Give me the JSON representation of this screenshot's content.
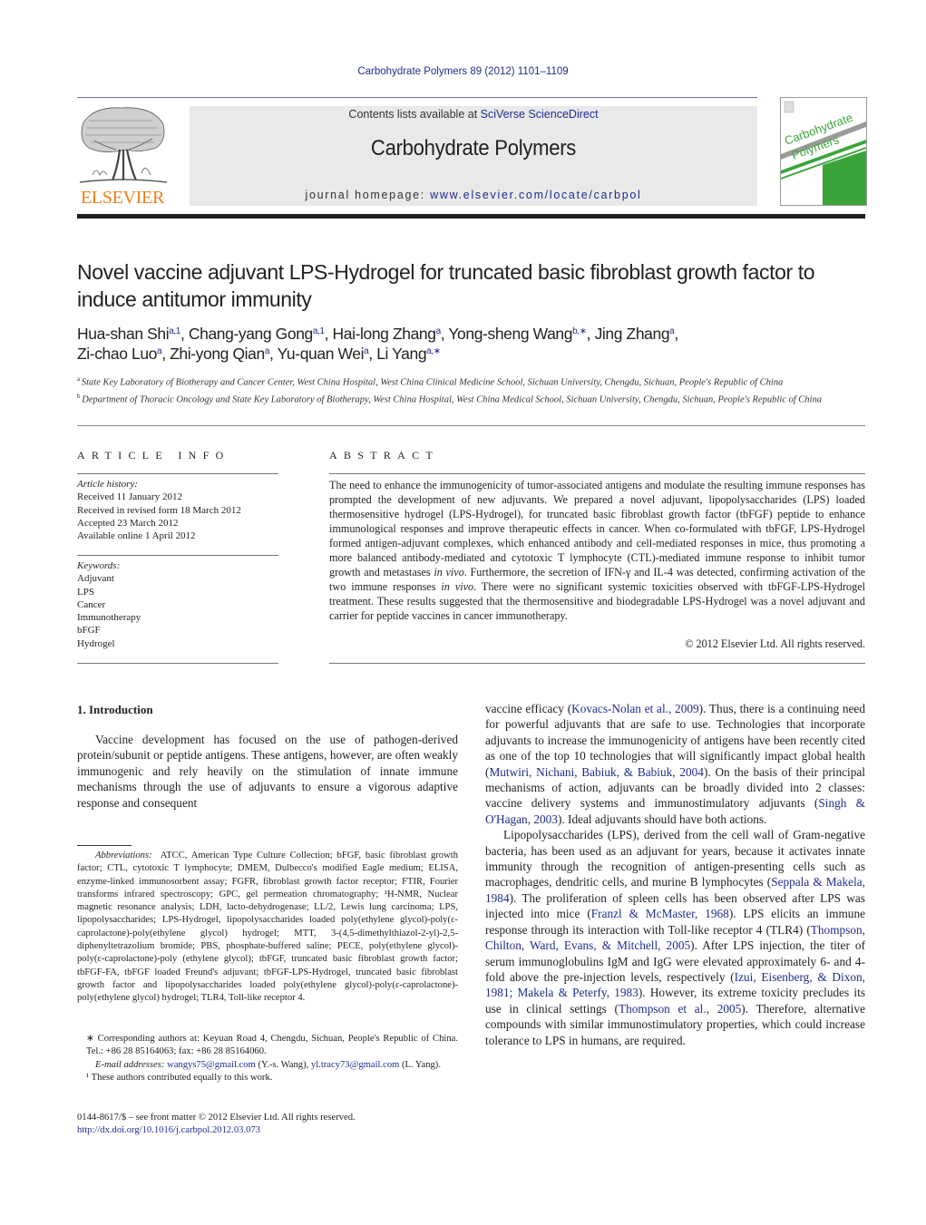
{
  "header": {
    "journal_reference": "Carbohydrate Polymers 89 (2012) 1101–1109",
    "publisher_logo_text": "ELSEVIER",
    "contents_prefix": "Contents lists available at ",
    "contents_link": "SciVerse ScienceDirect",
    "journal_title": "Carbohydrate Polymers",
    "homepage_prefix": "journal homepage: ",
    "homepage_link": "www.elsevier.com/locate/carbpol",
    "cover_title_line1": "Carbohydrate",
    "cover_title_line2": "Polymers",
    "colors": {
      "link": "#1f2c8f",
      "elsevier_orange": "#f07f1a",
      "cover_green": "#3aa43a",
      "masthead_gray": "#e9e9e9"
    }
  },
  "article": {
    "title": "Novel vaccine adjuvant LPS-Hydrogel for truncated basic fibroblast growth factor to induce antitumor immunity",
    "authors": [
      {
        "name": "Hua-shan Shi",
        "sup": "a,1"
      },
      {
        "name": "Chang-yang Gong",
        "sup": "a,1"
      },
      {
        "name": "Hai-long Zhang",
        "sup": "a"
      },
      {
        "name": "Yong-sheng Wang",
        "sup": "b,∗"
      },
      {
        "name": "Jing Zhang",
        "sup": "a"
      },
      {
        "name": "Zi-chao Luo",
        "sup": "a"
      },
      {
        "name": "Zhi-yong Qian",
        "sup": "a"
      },
      {
        "name": "Yu-quan Wei",
        "sup": "a"
      },
      {
        "name": "Li Yang",
        "sup": "a,∗"
      }
    ],
    "affiliations": [
      {
        "key": "a",
        "text": "State Key Laboratory of Biotherapy and Cancer Center, West China Hospital, West China Clinical Medicine School, Sichuan University, Chengdu, Sichuan, People's Republic of China"
      },
      {
        "key": "b",
        "text": "Department of Thoracic Oncology and State Key Laboratory of Biotherapy, West China Hospital, West China Medical School, Sichuan University, Chengdu, Sichuan, People's Republic of China"
      }
    ]
  },
  "article_info": {
    "heading": "ARTICLE INFO",
    "history_label": "Article history:",
    "history": [
      "Received 11 January 2012",
      "Received in revised form 18 March 2012",
      "Accepted 23 March 2012",
      "Available online 1 April 2012"
    ],
    "keywords_label": "Keywords:",
    "keywords": [
      "Adjuvant",
      "LPS",
      "Cancer",
      "Immunotherapy",
      "bFGF",
      "Hydrogel"
    ]
  },
  "abstract": {
    "heading": "ABSTRACT",
    "part1": "The need to enhance the immunogenicity of tumor-associated antigens and modulate the resulting immune responses has prompted the development of new adjuvants. We prepared a novel adjuvant, lipopolysaccharides (LPS) loaded thermosensitive hydrogel (LPS-Hydrogel), for truncated basic fibroblast growth factor (tbFGF) peptide to enhance immunological responses and improve therapeutic effects in cancer. When co-formulated with tbFGF, LPS-Hydrogel formed antigen-adjuvant complexes, which enhanced antibody and cell-mediated responses in mice, thus promoting a more balanced antibody-mediated and cytotoxic T lymphocyte (CTL)-mediated immune response to inhibit tumor growth and metastases ",
    "italic1": "in vivo",
    "part2": ". Furthermore, the secretion of IFN-γ and IL-4 was detected, confirming activation of the two immune responses ",
    "italic2": "in vivo",
    "part3": ". There were no significant systemic toxicities observed with tbFGF-LPS-Hydrogel treatment. These results suggested that the thermosensitive and biodegradable LPS-Hydrogel was a novel adjuvant and carrier for peptide vaccines in cancer immunotherapy.",
    "copyright": "© 2012 Elsevier Ltd. All rights reserved."
  },
  "introduction": {
    "heading": "1.  Introduction",
    "left_paragraph": "Vaccine development has focused on the use of pathogen-derived protein/subunit or peptide antigens. These antigens, however, are often weakly immunogenic and rely heavily on the stimulation of innate immune mechanisms through the use of adjuvants to ensure a vigorous adaptive response and consequent",
    "right_p1": [
      {
        "t": "vaccine efficacy ("
      },
      {
        "t": "Kovacs-Nolan et al., 2009",
        "link": true
      },
      {
        "t": "). Thus, there is a continuing need for powerful adjuvants that are safe to use. Technologies that incorporate adjuvants to increase the immunogenicity of antigens have been recently cited as one of the top 10 technologies that will significantly impact global health ("
      },
      {
        "t": "Mutwiri, Nichani, Babiuk, & Babiuk, 2004",
        "link": true
      },
      {
        "t": "). On the basis of their principal mechanisms of action, adjuvants can be broadly divided into 2 classes: vaccine delivery systems and immunostimulatory adjuvants ("
      },
      {
        "t": "Singh & O'Hagan, 2003",
        "link": true
      },
      {
        "t": "). Ideal adjuvants should have both actions."
      }
    ],
    "right_p2": [
      {
        "t": "Lipopolysaccharides (LPS), derived from the cell wall of Gram-negative bacteria, has been used as an adjuvant for years, because it activates innate immunity through the recognition of antigen-presenting cells such as macrophages, dendritic cells, and murine B lymphocytes ("
      },
      {
        "t": "Seppala & Makela, 1984",
        "link": true
      },
      {
        "t": "). The proliferation of spleen cells has been observed after LPS was injected into mice ("
      },
      {
        "t": "Franzl & McMaster, 1968",
        "link": true
      },
      {
        "t": "). LPS elicits an immune response through its interaction with Toll-like receptor 4 (TLR4) ("
      },
      {
        "t": "Thompson, Chilton, Ward, Evans, & Mitchell, 2005",
        "link": true
      },
      {
        "t": "). After LPS injection, the titer of serum immunoglobulins IgM and IgG were elevated approximately 6- and 4-fold above the pre-injection levels, respectively ("
      },
      {
        "t": "Izui, Eisenberg, & Dixon, 1981; Makela & Peterfy, 1983",
        "link": true
      },
      {
        "t": "). However, its extreme toxicity precludes its use in clinical settings ("
      },
      {
        "t": "Thompson et al., 2005",
        "link": true
      },
      {
        "t": "). Therefore, alternative compounds with similar immunostimulatory properties, which could increase tolerance to LPS in humans, are required."
      }
    ]
  },
  "footnotes": {
    "abbreviations_label": "Abbreviations:",
    "abbreviations_text": "ATCC, American Type Culture Collection; bFGF, basic fibroblast growth factor; CTL, cytotoxic T lymphocyte; DMEM, Dulbecco's modified Eagle medium; ELISA, enzyme-linked immunosorbent assay; FGFR, fibroblast growth factor receptor; FTIR, Fourier transforms infrared spectroscopy; GPC, gel permeation chromatography; ¹H-NMR, Nuclear magnetic resonance analysis; LDH, lacto-dehydrogenase; LL/2, Lewis lung carcinoma; LPS, lipopolysaccharides; LPS-Hydrogel, lipopolysaccharides loaded poly(ethylene glycol)-poly(ε-caprolactone)-poly(ethylene glycol) hydrogel; MTT, 3-(4,5-dimethylthiazol-2-yl)-2,5-diphenyltetrazolium bromide; PBS, phosphate-buffered saline; PECE, poly(ethylene glycol)-poly(ε-caprolactone)-poly (ethylene glycol); tbFGF, truncated basic fibroblast growth factor; tbFGF-FA, tbFGF loaded Freund's adjuvant; tbFGF-LPS-Hydrogel, truncated basic fibroblast growth factor and lipopolysaccharides loaded poly(ethylene glycol)-poly(ε-caprolactone)-poly(ethylene glycol) hydrogel; TLR4, Toll-like receptor 4.",
    "corresponding": "∗ Corresponding authors at: Keyuan Road 4, Chengdu, Sichuan, People's Republic of China. Tel.: +86 28 85164063; fax: +86 28 85164060.",
    "email_label": "E-mail addresses:",
    "email1": "wangys75@gmail.com",
    "email1_owner": " (Y.-s. Wang), ",
    "email2": "yl.tracy73@gmail.com",
    "email2_owner": " (L. Yang).",
    "equal_contribution": "¹  These authors contributed equally to this work.",
    "front_matter": "0144-8617/$ – see front matter © 2012 Elsevier Ltd. All rights reserved.",
    "doi": "http://dx.doi.org/10.1016/j.carbpol.2012.03.073"
  }
}
